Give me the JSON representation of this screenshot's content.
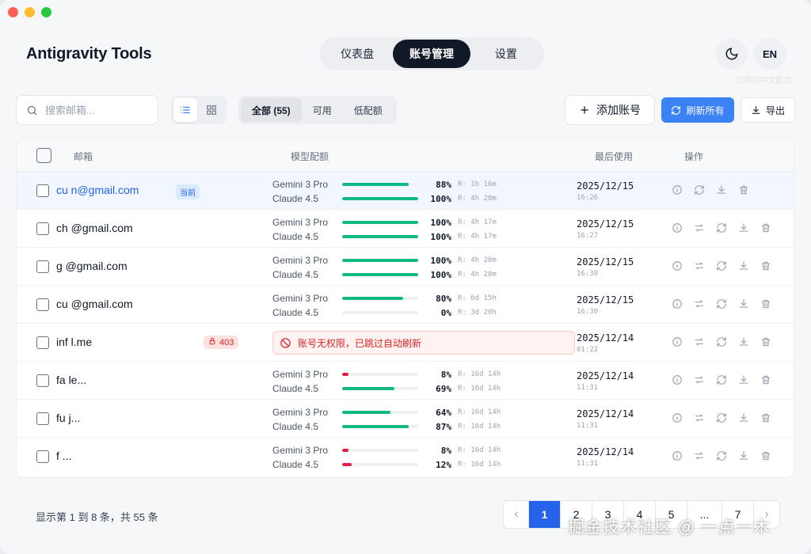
{
  "app": {
    "title": "Antigravity Tools"
  },
  "nav": {
    "tabs": [
      {
        "label": "仪表盘"
      },
      {
        "label": "账号管理"
      },
      {
        "label": "设置"
      }
    ]
  },
  "header": {
    "lang_label": "EN",
    "lang_hint": "切换到中文模式"
  },
  "toolbar": {
    "search_placeholder": "搜索邮箱...",
    "filters": [
      {
        "label": "全部 (55)"
      },
      {
        "label": "可用"
      },
      {
        "label": "低配额"
      }
    ],
    "add_label": "添加账号",
    "refresh_label": "刷新所有",
    "export_label": "导出"
  },
  "table": {
    "headers": {
      "email": "邮箱",
      "quota": "模型配额",
      "last_used": "最后使用",
      "actions": "操作"
    },
    "rows": [
      {
        "email": "cu          n@gmail.com",
        "badge": "当前",
        "quotas": [
          {
            "model": "Gemini 3 Pro",
            "pct": "88%",
            "value": 88,
            "reset": "R: 1h 16m"
          },
          {
            "model": "Claude 4.5",
            "pct": "100%",
            "value": 100,
            "reset": "R: 4h 20m"
          }
        ],
        "date": "2025/12/15",
        "time": "16:26"
      },
      {
        "email": "ch           @gmail.com",
        "quotas": [
          {
            "model": "Gemini 3 Pro",
            "pct": "100%",
            "value": 100,
            "reset": "R: 4h 17m"
          },
          {
            "model": "Claude 4.5",
            "pct": "100%",
            "value": 100,
            "reset": "R: 4h 17m"
          }
        ],
        "date": "2025/12/15",
        "time": "16:27"
      },
      {
        "email": "g            @gmail.com",
        "quotas": [
          {
            "model": "Gemini 3 Pro",
            "pct": "100%",
            "value": 100,
            "reset": "R: 4h 20m"
          },
          {
            "model": "Claude 4.5",
            "pct": "100%",
            "value": 100,
            "reset": "R: 4h 20m"
          }
        ],
        "date": "2025/12/15",
        "time": "16:30"
      },
      {
        "email": "cu           @gmail.com",
        "quotas": [
          {
            "model": "Gemini 3 Pro",
            "pct": "80%",
            "value": 80,
            "reset": "R: 6d 15h"
          },
          {
            "model": "Claude 4.5",
            "pct": "0%",
            "value": 0,
            "reset": "R: 3d 20h"
          }
        ],
        "date": "2025/12/15",
        "time": "16:30"
      },
      {
        "email": "inf                       l.me",
        "badge": "403",
        "error": "账号无权限，已跳过自动刷新",
        "date": "2025/12/14",
        "time": "01:22"
      },
      {
        "email": "fa                              le...",
        "quotas": [
          {
            "model": "Gemini 3 Pro",
            "pct": "8%",
            "value": 8,
            "reset": "R: 16d 14h"
          },
          {
            "model": "Claude 4.5",
            "pct": "69%",
            "value": 69,
            "reset": "R: 16d 14h"
          }
        ],
        "date": "2025/12/14",
        "time": "11:31"
      },
      {
        "email": "fu                              j...",
        "quotas": [
          {
            "model": "Gemini 3 Pro",
            "pct": "64%",
            "value": 64,
            "reset": "R: 16d 14h"
          },
          {
            "model": "Claude 4.5",
            "pct": "87%",
            "value": 87,
            "reset": "R: 16d 14h"
          }
        ],
        "date": "2025/12/14",
        "time": "11:31"
      },
      {
        "email": "f                              ...",
        "quotas": [
          {
            "model": "Gemini 3 Pro",
            "pct": "8%",
            "value": 8,
            "reset": "R: 16d 14h"
          },
          {
            "model": "Claude 4.5",
            "pct": "12%",
            "value": 12,
            "reset": "R: 16d 14h"
          }
        ],
        "date": "2025/12/14",
        "time": "11:31"
      }
    ]
  },
  "footer": {
    "summary": "显示第 1 到 8 条，共 55 条"
  },
  "pagination": {
    "pages": [
      "1",
      "2",
      "3",
      "4",
      "5",
      "...",
      "7"
    ],
    "current": "1"
  },
  "watermark": "掘金技术社区 @ 一点一木",
  "colors": {
    "accent": "#2563eb",
    "quota_ok": "#10b981",
    "quota_low": "#e11d48",
    "error": "#dc2626"
  }
}
